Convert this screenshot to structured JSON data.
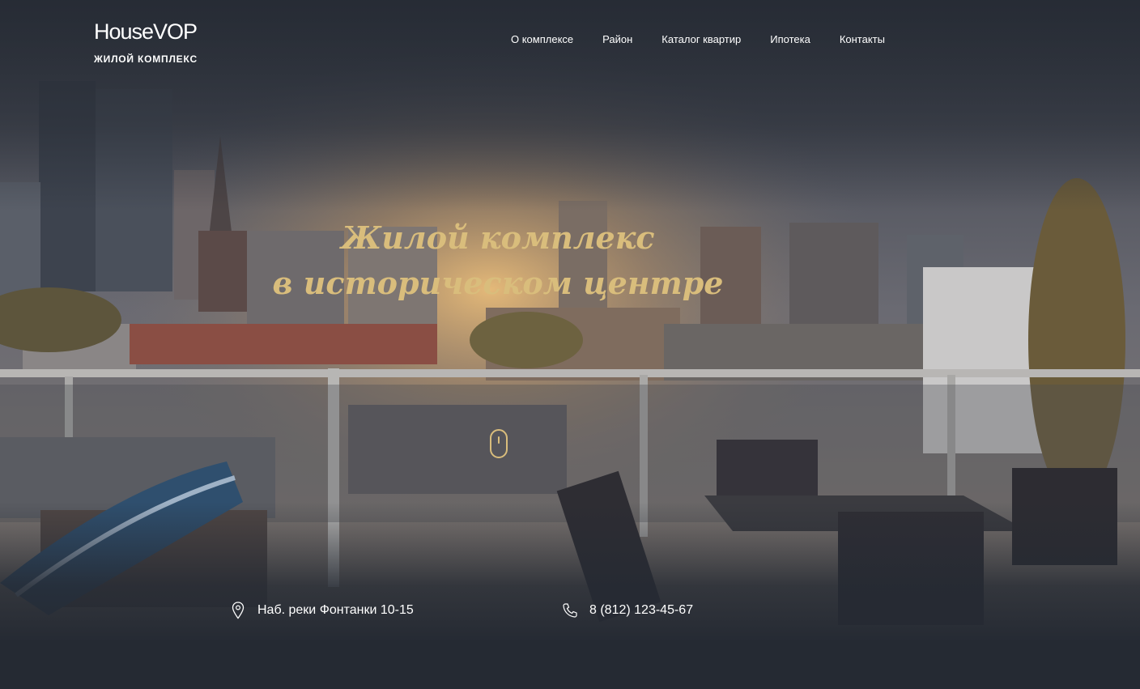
{
  "header": {
    "logo_name": "HouseVOP",
    "logo_subtitle": "ЖИЛОЙ КОМПЛЕКС",
    "nav": [
      {
        "label": "О комплексе"
      },
      {
        "label": "Район"
      },
      {
        "label": "Каталог квартир"
      },
      {
        "label": "Ипотека"
      },
      {
        "label": "Контакты"
      }
    ]
  },
  "hero": {
    "title_line1": "Жилой комплекс",
    "title_line2": "в историческом центре",
    "scroll_icon": "mouse-scroll-icon"
  },
  "contacts": {
    "address": "Наб. реки Фонтанки 10-15",
    "address_icon": "map-pin-icon",
    "phone": "8 (812) 123-45-67",
    "phone_icon": "phone-icon"
  },
  "colors": {
    "accent_gold": "#d9bd7c",
    "background": "#252a33",
    "text": "#ffffff"
  }
}
